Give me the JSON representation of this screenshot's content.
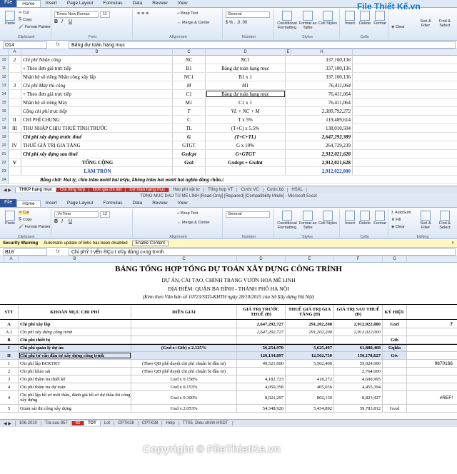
{
  "top": {
    "tabs": [
      "File",
      "Home",
      "Insert",
      "Page Layout",
      "Formulas",
      "Data",
      "Review",
      "View"
    ],
    "clipboard": {
      "paste": "Paste",
      "cut": "Cut",
      "copy": "Copy",
      "format_painter": "Format Painter",
      "label": "Clipboard"
    },
    "font": {
      "name": "Times New Roman",
      "size": "11",
      "label": "Font"
    },
    "alignment": {
      "wrap": "Wrap Text",
      "merge": "Merge & Center",
      "label": "Alignment"
    },
    "number": {
      "format": "General",
      "label": "Number"
    },
    "styles": {
      "cond": "Conditional Formatting",
      "table": "Format as Table",
      "cell": "Cell Styles",
      "label": "Styles"
    },
    "cells": {
      "insert": "Insert",
      "delete": "Delete",
      "format": "Format",
      "label": "Cells"
    },
    "editing": {
      "clear": "Clear",
      "sort": "Sort & Filter",
      "find": "Find & Select"
    },
    "logo": "File Thiết Kế.vn",
    "namebox": "D14",
    "formula": "Bảng dự toán hạng mục",
    "columns": [
      "A",
      "B",
      "C",
      "D",
      "E",
      "H"
    ],
    "rows": [
      {
        "n": "10",
        "a": "2",
        "b": "Chi phí Nhân công",
        "c": "NC",
        "d": "NC1",
        "h": "337,100,136",
        "style": "it"
      },
      {
        "n": "11",
        "a": "",
        "b": "+ Theo đơn giá trực tiếp",
        "c": "B1",
        "d": "Bảng dự toán hạng mục",
        "h": "337,100,136",
        "style": ""
      },
      {
        "n": "12",
        "a": "",
        "b": "Nhân hệ số riêng Nhân công xây lắp",
        "c": "NC1",
        "d": "B1 x 1",
        "h": "337,100,136",
        "style": ""
      },
      {
        "n": "13",
        "a": "3",
        "b": "Chi phí Máy thi công",
        "c": "M",
        "d": "M1",
        "h": "76,411,064",
        "style": "it"
      },
      {
        "n": "14",
        "a": "",
        "b": "+ Theo đơn giá trực tiếp",
        "c": "C1",
        "d": "Bảng dự toán hạng mục",
        "h": "76,411,064",
        "style": ""
      },
      {
        "n": "15",
        "a": "",
        "b": "Nhân hệ số riêng Máy",
        "c": "M1",
        "d": "C1 x 1",
        "h": "76,411,064",
        "style": ""
      },
      {
        "n": "16",
        "a": "",
        "b": "Cộng chi phí trực tiếp",
        "c": "T",
        "d": "VL + NC + M",
        "h": "2,389,792,272",
        "style": "it"
      },
      {
        "n": "17",
        "a": "II",
        "b": "CHI PHÍ CHUNG",
        "c": "C",
        "d": "T x 5%",
        "h": "119,489,614",
        "style": ""
      },
      {
        "n": "18",
        "a": "III",
        "b": "THU NHẬP CHỊU THUẾ TÍNH TRƯỚC",
        "c": "TL",
        "d": "(T+C) x 5.5%",
        "h": "138,010,504",
        "style": ""
      },
      {
        "n": "19",
        "a": "",
        "b": "Chi phí xây dựng trước thuế",
        "c": "G",
        "d": "(T+C+TL)",
        "h": "2,647,292,389",
        "style": "bi"
      },
      {
        "n": "20",
        "a": "IV",
        "b": "THUẾ GIÁ TRỊ GIA TĂNG",
        "c": "GTGT",
        "d": "G x 10%",
        "h": "264,729,239",
        "style": ""
      },
      {
        "n": "21",
        "a": "",
        "b": "Chi phí xây dựng sau thuế",
        "c": "Gxdcpt",
        "d": "G+GTGT",
        "h": "2,912,021,628",
        "style": "bi"
      },
      {
        "n": "22",
        "a": "V",
        "b": "TỔNG CỘNG",
        "c": "Gxd",
        "d": "Gxdcpt + Gxdnt",
        "h": "2,912,021,628",
        "style": "b"
      },
      {
        "n": "23",
        "a": "",
        "b": "LÀM TRÒN",
        "c": "",
        "d": "",
        "h": "2,912,022,000",
        "style": "blue"
      },
      {
        "n": "24",
        "a": "",
        "b": "Bằng chữ: Hai tỷ, chín trăm mười hai triệu, không trăm hai mươi hai nghìn đồng chẵn./.",
        "c": "",
        "d": "",
        "h": "",
        "style": "words"
      }
    ],
    "sheet_tabs": [
      "THKP hạng mục",
      "Giá tổng hợp",
      "Đơn giá chi tiết",
      "Dự toán hạng mục",
      "Hao phí vật tư",
      "Tổng hợp VT",
      "Cước VC",
      "Cước bộ",
      "HSXL"
    ]
  },
  "bottom": {
    "window_title": "TONG MUC DAU TU ME LINH  [Read-Only] [Repaired]  [Compatibility Mode] - Microsoft Excel",
    "tabs": [
      "File",
      "Home",
      "Insert",
      "Page Layout",
      "Formulas",
      "Data",
      "Review",
      "View"
    ],
    "font": {
      "name": ".VnTime",
      "size": "12"
    },
    "clipboard": {
      "cut": "Cut",
      "copy": "Copy",
      "format_painter": "Format Painter",
      "paste": "Paste",
      "label": "Clipboard"
    },
    "alignment": {
      "wrap": "Wrap Text",
      "merge": "Merge & Center",
      "label": "Alignment"
    },
    "number": {
      "format": "General",
      "label": "Number"
    },
    "styles": {
      "cond": "Conditional Formatting",
      "table": "Format as Table",
      "cell": "Cell Styles",
      "label": "Styles"
    },
    "cells": {
      "insert": "Insert",
      "delete": "Delete",
      "format": "Format",
      "label": "Cells"
    },
    "editing": {
      "autosum": "AutoSum",
      "fill": "Fill",
      "clear": "Clear",
      "sort": "Sort & Filter",
      "find": "Find & Select",
      "label": "Editing"
    },
    "security": {
      "title": "Security Warning",
      "message": "Automatic update of links has been disabled",
      "button": "Enable Content"
    },
    "namebox": "B18",
    "formula": "Chi phÝ t­ vÊn ®Çu t­ x©y dùng c«ng tr×nh",
    "columns": [
      "A",
      "B",
      "C",
      "D",
      "E",
      "F",
      "G"
    ],
    "heading": "BẢNG TỔNG HỢP TỔNG DỰ TOÁN XÂY DỰNG CÔNG TRÌNH",
    "project": "DỰ ÁN, CẢI TẠO, CHỈNH TRANG VƯỜN HOA MÊ LINH",
    "location": "ĐỊA ĐIỂM: QUẬN BA ĐÌNH - THÀNH PHỐ HÀ NỘI",
    "note": "(Kèm theo Văn bản số 10723/SXD-KHTH ngày 28/10/2015 của Sở Xây dựng Hà Nội)",
    "headers": {
      "stt": "STT",
      "item": "KHOẢN MỤC CHI PHÍ",
      "explain": "DIỄN GIẢI",
      "before": "GIÁ TRỊ TRƯỚC THUẾ (Đ)",
      "vat": "THUẾ GIÁ TRỊ GIA TĂNG (Đ)",
      "after": "GIÁ TRỊ SAU THUẾ (Đ)",
      "sym": "KÝ HIỆU"
    },
    "rows": [
      {
        "n": "10",
        "stt": "A",
        "item": "Chi phí xây lắp",
        "explain": "",
        "before": "2,647,292,727",
        "vat": "291,202,200",
        "after": "2,912,022,000",
        "sym": "Gxd",
        "g": "7",
        "style": "b"
      },
      {
        "n": "11",
        "stt": "A.1",
        "item": "Chi phí xây dựng công trình",
        "explain": "",
        "before": "2,647,292,727",
        "vat": "291,202,200",
        "after": "2,912,022,000",
        "sym": "",
        "g": "",
        "style": "it"
      },
      {
        "n": "12",
        "stt": "B",
        "item": "Chi phí thiết bị",
        "explain": "",
        "before": "",
        "vat": "",
        "after": "",
        "sym": "Gtb",
        "g": "",
        "style": "b"
      },
      {
        "n": "17",
        "stt": "I",
        "item": "Chi phí quản lý dự án",
        "explain": "(Gxd x+Gtb) x 2.125%",
        "before": "56,254,970",
        "vat": "5,625,497",
        "after": "61,880,468",
        "sym": "Gqlda",
        "g": "",
        "style": "b"
      },
      {
        "n": "18",
        "stt": "II",
        "item": "Chi phí tư vấn đầu tư xây dựng công trình",
        "explain": "",
        "before": "120,134,897",
        "vat": "12,562,730",
        "after": "150,178,627",
        "sym": "Gtv",
        "g": "",
        "style": "b"
      },
      {
        "n": "19",
        "stt": "1",
        "item": "Chi phí lập BCKTKT",
        "explain": "(Theo QĐ phê duyệt chi phí chuẩn bị đầu tư)",
        "before": "49,521,600",
        "vat": "5,502,400",
        "after": "55,024,000",
        "sym": "",
        "g": "9870166",
        "style": ""
      },
      {
        "n": "20",
        "stt": "2",
        "item": "Chi phí khảo sát",
        "explain": "(Theo QĐ phê duyệt chi phí chuẩn bị đầu tư)",
        "before": "",
        "vat": "",
        "after": "2,764,000",
        "sym": "",
        "g": "",
        "style": ""
      },
      {
        "n": "21",
        "stt": "3",
        "item": "Chi phí thẩm tra thiết kế",
        "explain": "Gxd x 0.158%",
        "before": "4,182,723",
        "vat": "418,272",
        "after": "4,600,995",
        "sym": "",
        "g": "",
        "style": ""
      },
      {
        "n": "22",
        "stt": "4",
        "item": "Chi phí thẩm tra dự toán",
        "explain": "Gxd x 0.153%",
        "before": "4,050,358",
        "vat": "405,036",
        "after": "4,455,394",
        "sym": "",
        "g": "",
        "style": ""
      },
      {
        "n": "23",
        "stt": "4",
        "item": "Chi phí lập hồ sơ mời thầu, đánh giá hồ sơ dự thầu thi công xây dựng",
        "explain": "Gxd x 0.300%",
        "before": "8,021,297",
        "vat": "802,130",
        "after": "8,823,427",
        "sym": "",
        "g": "#REF!",
        "style": "tall"
      },
      {
        "n": "24",
        "stt": "5",
        "item": "Giám sát thi công xây dựng",
        "explain": "Gxd x 2.053%",
        "before": "54,348,920",
        "vat": "5,434,892",
        "after": "59,783,812",
        "sym": "Gsxd",
        "g": "",
        "style": ""
      }
    ],
    "sheet_tabs": [
      "106.2010",
      "Tra cuu 957",
      "tkt",
      "TDT",
      "Lot",
      "CPTK28",
      "CPTK38",
      "Help",
      "TT05, Dieu chinh HSDT"
    ]
  },
  "watermark": "Copyright © FileThietKe.vn"
}
